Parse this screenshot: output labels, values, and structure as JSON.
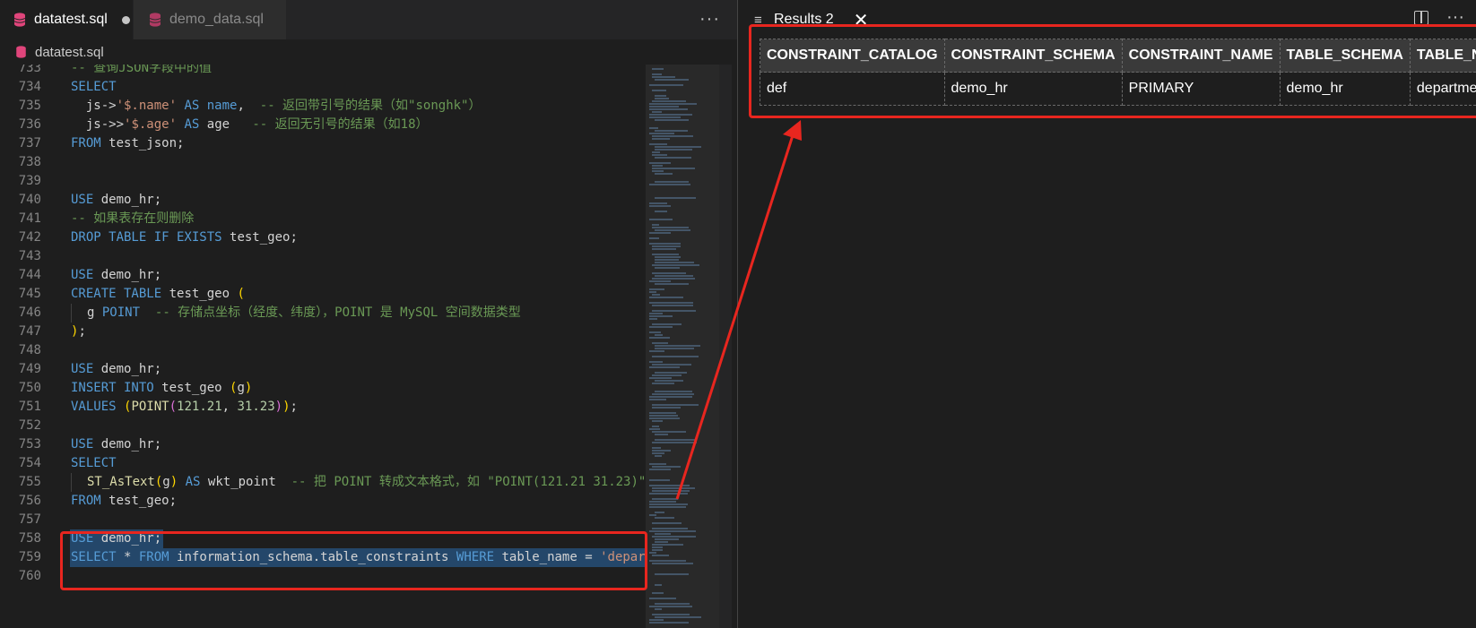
{
  "tabs": [
    {
      "label": "datatest.sql",
      "active": true,
      "dirty": true
    },
    {
      "label": "demo_data.sql",
      "active": false,
      "dirty": false
    }
  ],
  "breadcrumb": "datatest.sql",
  "more_label": "···",
  "results_panel": {
    "tab_label": "Results 2",
    "close_label": "✕",
    "more_label": "···",
    "columns": [
      "CONSTRAINT_CATALOG",
      "CONSTRAINT_SCHEMA",
      "CONSTRAINT_NAME",
      "TABLE_SCHEMA",
      "TABLE_NAME"
    ],
    "rows": [
      [
        "def",
        "demo_hr",
        "PRIMARY",
        "demo_hr",
        "departments"
      ]
    ]
  },
  "code": {
    "l733": "-- 查询JSON字段中的值",
    "l735_str": "'$.name'",
    "l735_alias": "name",
    "l735_cm": "-- 返回带引号的结果（如\"songhk\"）",
    "l736_str": "'$.age'",
    "l736_alias": "age",
    "l736_cm": "-- 返回无引号的结果（如18）",
    "l737_tbl": "test_json;",
    "db": "demo_hr;",
    "l741": "-- 如果表存在则删除",
    "l742_tbl": "test_geo;",
    "l745_tbl": "test_geo",
    "l746_col": "g",
    "l746_cm": "-- 存储点坐标（经度、纬度），POINT 是 MySQL 空间数据类型",
    "l750_tbl": "test_geo",
    "l751_x": "121.21",
    "l751_y": "31.23",
    "l755_alias": "wkt_point",
    "l755_cm": "-- 把 POINT 转成文本格式，如 \"POINT(121.21 31.23)\"",
    "l756_tbl": "test_geo;",
    "l759_tbl": "information_schema.table_constraints",
    "l759_col": "table_name",
    "l759_str": "'departments';"
  }
}
